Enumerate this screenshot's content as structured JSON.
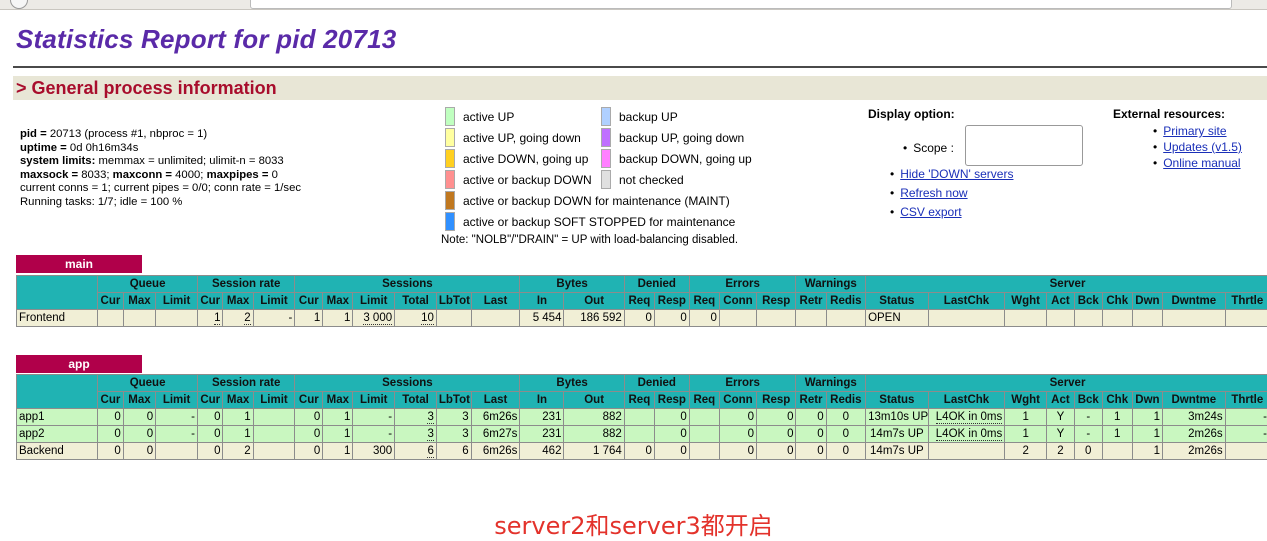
{
  "title": "Statistics Report for pid 20713",
  "section": "> General process information",
  "process": {
    "l1a": "pid = ",
    "l1b": "20713 (process #1, nbproc = 1)",
    "l2a": "uptime = ",
    "l2b": "0d 0h16m34s",
    "l3a": "system limits:",
    "l3b": " memmax = unlimited; ulimit-n = 8033",
    "l4a": "maxsock = ",
    "l4b": "8033; ",
    "l4c": "maxconn = ",
    "l4d": "4000; ",
    "l4e": "maxpipes = ",
    "l4f": "0",
    "l5": "current conns = 1; current pipes = 0/0; conn rate = 1/sec",
    "l6": "Running tasks: 1/7; idle = 100 %"
  },
  "legend": {
    "items": [
      {
        "label": "active UP",
        "color": "#c0ffc0"
      },
      {
        "label": "active UP, going down",
        "color": "#ffffa0"
      },
      {
        "label": "active DOWN, going up",
        "color": "#ffd020"
      },
      {
        "label": "active or backup DOWN",
        "color": "#ff9090"
      },
      {
        "label": "active or backup DOWN for maintenance (MAINT)",
        "color": "#c07820"
      },
      {
        "label": "active or backup SOFT STOPPED for maintenance",
        "color": "#3090ff"
      },
      {
        "label": "backup UP",
        "color": "#b0d0ff"
      },
      {
        "label": "backup UP, going down",
        "color": "#c070ff"
      },
      {
        "label": "backup DOWN, going up",
        "color": "#ff80ff"
      },
      {
        "label": "not checked",
        "color": "#e0e0e0"
      }
    ],
    "note": "Note: \"NOLB\"/\"DRAIN\" = UP with load-balancing disabled."
  },
  "display": {
    "heading": "Display option:",
    "scope_label": "Scope :",
    "scope_value": "",
    "links": [
      "Hide 'DOWN' servers",
      "Refresh now",
      "CSV export"
    ]
  },
  "external": {
    "heading": "External resources:",
    "links": [
      "Primary site",
      "Updates (v1.5)",
      "Online manual"
    ]
  },
  "main": {
    "name": "main",
    "groups": [
      "Queue",
      "Session rate",
      "Sessions",
      "Bytes",
      "Denied",
      "Errors",
      "Warnings",
      "Server"
    ],
    "cols": [
      "Cur",
      "Max",
      "Limit",
      "Cur",
      "Max",
      "Limit",
      "Cur",
      "Max",
      "Limit",
      "Total",
      "LbTot",
      "Last",
      "In",
      "Out",
      "Req",
      "Resp",
      "Req",
      "Conn",
      "Resp",
      "Retr",
      "Redis",
      "Status",
      "LastChk",
      "Wght",
      "Act",
      "Bck",
      "Chk",
      "Dwn",
      "Dwntme",
      "Thrtle"
    ],
    "frontend": [
      "Frontend",
      "",
      "",
      "",
      "1",
      "2",
      "-",
      "1",
      "1",
      "3 000",
      "10",
      "",
      "",
      "5 454",
      "186 592",
      "0",
      "0",
      "0",
      "",
      "",
      "",
      "",
      "OPEN",
      "",
      "",
      "",
      "",
      "",
      "",
      "",
      ""
    ]
  },
  "app": {
    "name": "app",
    "groups": [
      "Queue",
      "Session rate",
      "Sessions",
      "Bytes",
      "Denied",
      "Errors",
      "Warnings",
      "Server"
    ],
    "cols": [
      "Cur",
      "Max",
      "Limit",
      "Cur",
      "Max",
      "Limit",
      "Cur",
      "Max",
      "Limit",
      "Total",
      "LbTot",
      "Last",
      "In",
      "Out",
      "Req",
      "Resp",
      "Req",
      "Conn",
      "Resp",
      "Retr",
      "Redis",
      "Status",
      "LastChk",
      "Wght",
      "Act",
      "Bck",
      "Chk",
      "Dwn",
      "Dwntme",
      "Thrtle"
    ],
    "rows": [
      [
        "app1",
        "0",
        "0",
        "-",
        "0",
        "1",
        "",
        "0",
        "1",
        "-",
        "3",
        "3",
        "6m26s",
        "231",
        "882",
        "",
        "0",
        "",
        "0",
        "0",
        "0",
        "0",
        "13m10s UP",
        "L4OK in 0ms",
        "1",
        "Y",
        "-",
        "1",
        "1",
        "3m24s",
        "-"
      ],
      [
        "app2",
        "0",
        "0",
        "-",
        "0",
        "1",
        "",
        "0",
        "1",
        "-",
        "3",
        "3",
        "6m27s",
        "231",
        "882",
        "",
        "0",
        "",
        "0",
        "0",
        "0",
        "0",
        "14m7s UP",
        "L4OK in 0ms",
        "1",
        "Y",
        "-",
        "1",
        "1",
        "2m26s",
        "-"
      ],
      [
        "Backend",
        "0",
        "0",
        "",
        "0",
        "2",
        "",
        "0",
        "1",
        "300",
        "6",
        "6",
        "6m26s",
        "462",
        "1 764",
        "0",
        "0",
        "",
        "0",
        "0",
        "0",
        "0",
        "14m7s UP",
        "",
        "2",
        "2",
        "0",
        "",
        "1",
        "2m26s",
        ""
      ]
    ]
  },
  "caption": "server2和server3都开启"
}
